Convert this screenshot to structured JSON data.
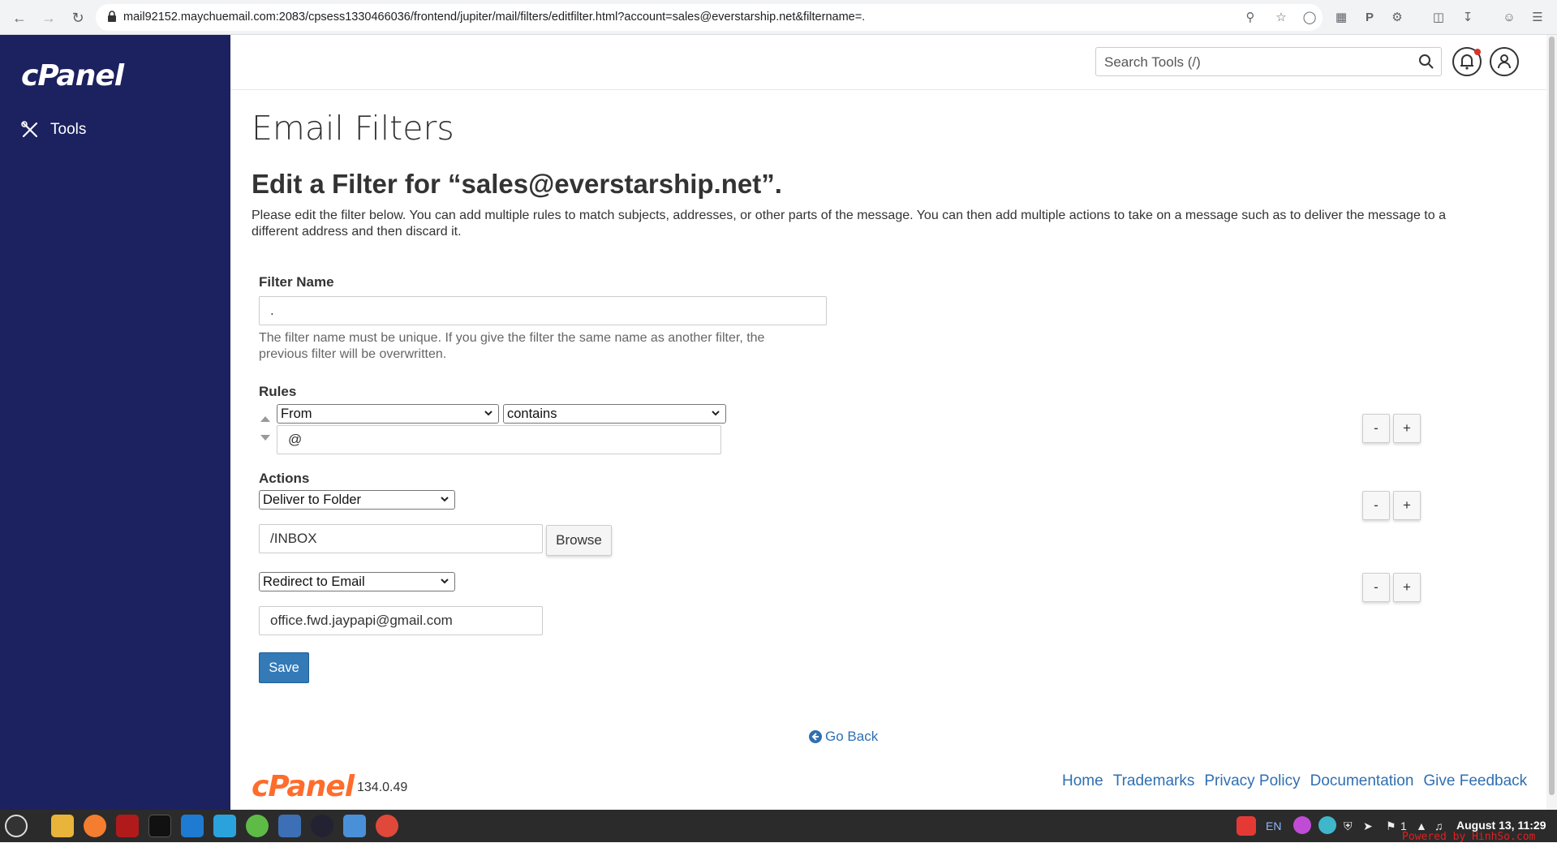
{
  "browser": {
    "url": "mail92152.maychuemail.com:2083/cpsess1330466036/frontend/jupiter/mail/filters/editfilter.html?account=sales@everstarship.net&filtername=."
  },
  "sidebar": {
    "logo": "cPanel",
    "items": [
      {
        "label": "Tools",
        "icon": "tools-icon"
      }
    ]
  },
  "header": {
    "search_placeholder": "Search Tools (/)"
  },
  "main": {
    "page_title": "Email Filters",
    "edit_title": "Edit a Filter for “sales@everstarship.net”.",
    "description": "Please edit the filter below. You can add multiple rules to match subjects, addresses, or other parts of the message. You can then add multiple actions to take on a message such as to deliver the message to a different address and then discard it.",
    "filter_name_label": "Filter Name",
    "filter_name_value": ".",
    "filter_name_help": "The filter name must be unique. If you give the filter the same name as another filter, the previous filter will be overwritten.",
    "rules_label": "Rules",
    "rule": {
      "field": "From",
      "operator": "contains",
      "value": "@"
    },
    "actions_label": "Actions",
    "actions": [
      {
        "type": "Deliver to Folder",
        "value": "/INBOX",
        "browse_label": "Browse"
      },
      {
        "type": "Redirect to Email",
        "value": "office.fwd.jaypapi@gmail.com"
      }
    ],
    "minus_label": "-",
    "plus_label": "+",
    "save_label": "Save",
    "go_back_label": "Go Back"
  },
  "footer": {
    "logo": "cPanel",
    "version": "134.0.49",
    "links": [
      "Home",
      "Trademarks",
      "Privacy Policy",
      "Documentation",
      "Give Feedback"
    ]
  },
  "taskbar": {
    "lang": "EN",
    "tray_count": "1",
    "clock": "August 13, 11:29",
    "watermark": "Powered by HinhSo.com"
  }
}
